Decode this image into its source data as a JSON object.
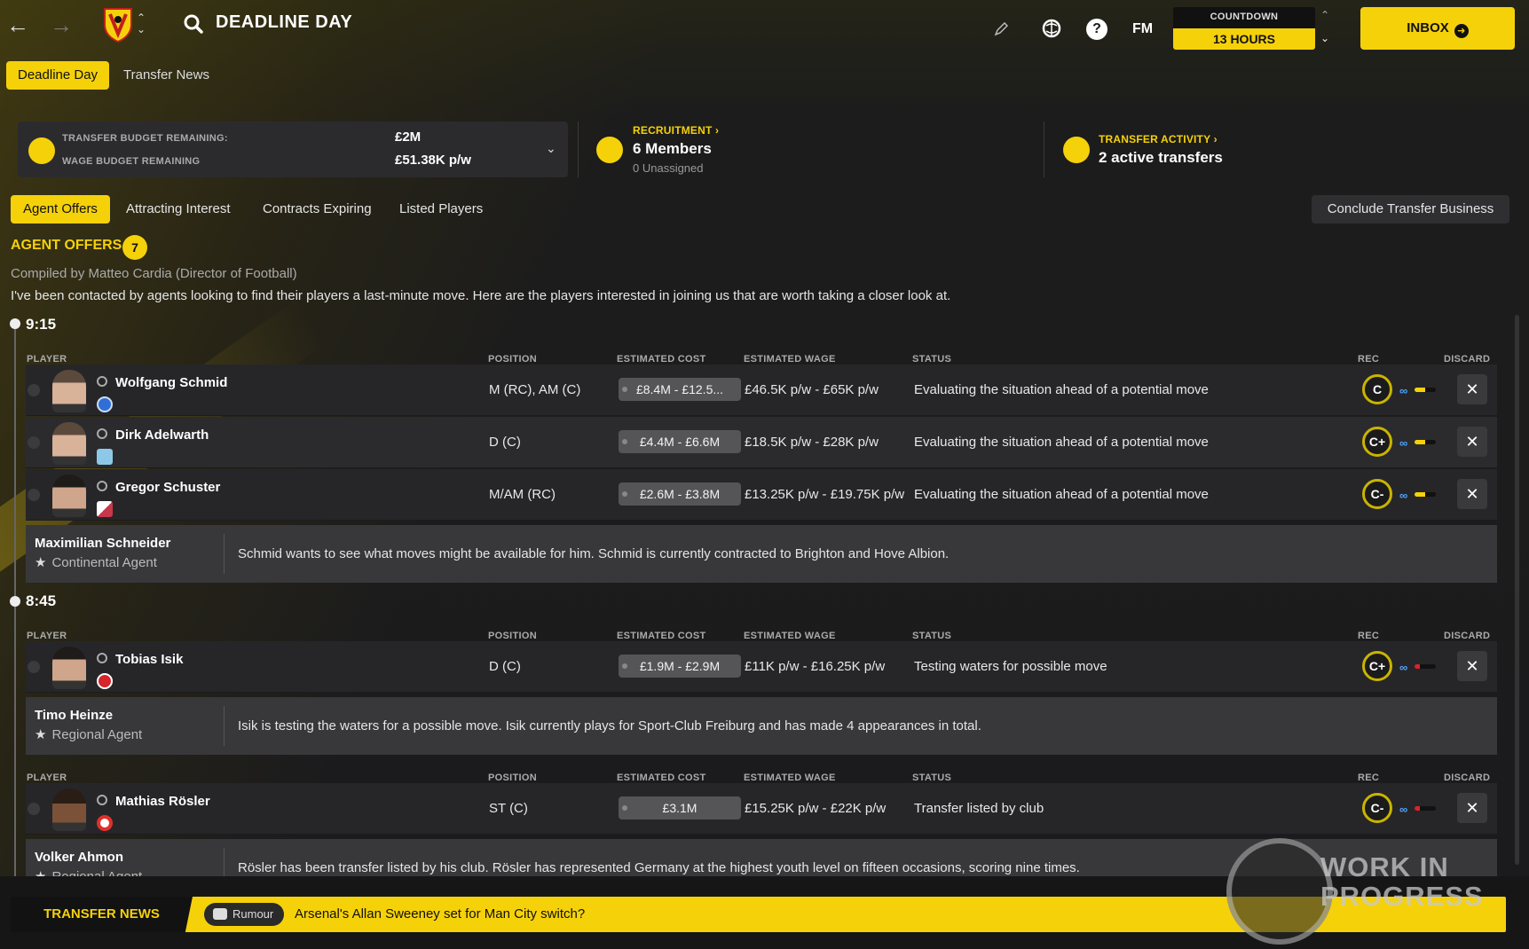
{
  "topbar": {
    "title": "DEADLINE DAY",
    "countdown_label": "COUNTDOWN",
    "countdown_value": "13 HOURS",
    "fm_label": "FM",
    "help_label": "?",
    "inbox_label": "INBOX"
  },
  "subtabs": [
    "Deadline Day",
    "Transfer News"
  ],
  "budget": {
    "transfer_label": "TRANSFER BUDGET REMAINING:",
    "transfer_value": "£2M",
    "wage_label": "WAGE BUDGET REMAINING",
    "wage_value": "£51.38K p/w"
  },
  "recruitment": {
    "link": "RECRUITMENT ›",
    "members": "6 Members",
    "unassigned": "0 Unassigned"
  },
  "transfer_activity": {
    "link": "TRANSFER ACTIVITY ›",
    "value": "2 active transfers"
  },
  "filter_tabs": [
    "Agent Offers",
    "Attracting Interest",
    "Contracts Expiring",
    "Listed Players"
  ],
  "conclude_label": "Conclude Transfer Business",
  "section": {
    "title": "AGENT OFFERS",
    "count": "7",
    "compiled": "Compiled by Matteo Cardia (Director of Football)",
    "intro": "I've been contacted by agents looking to find their players a last-minute move. Here are the players interested in joining us that are worth taking a closer look at."
  },
  "columns": {
    "player": "PLAYER",
    "position": "POSITION",
    "cost": "ESTIMATED COST",
    "wage": "ESTIMATED WAGE",
    "status": "STATUS",
    "rec": "REC",
    "discard": "DISCARD"
  },
  "groups": [
    {
      "time": "9:15",
      "players": [
        {
          "name": "Wolfgang Schmid",
          "position": "M (RC), AM (C)",
          "cost": "£8.4M - £12.5...",
          "wage": "£46.5K p/w - £65K p/w",
          "status": "Evaluating the situation ahead of a potential move",
          "rec": "C",
          "club_color": "#2f6fd6"
        },
        {
          "name": "Dirk Adelwarth",
          "position": "D (C)",
          "cost": "£4.4M - £6.6M",
          "wage": "£18.5K p/w - £28K p/w",
          "status": "Evaluating the situation ahead of a potential move",
          "rec": "C+",
          "club_color": "#8ec8e8"
        },
        {
          "name": "Gregor Schuster",
          "position": "M/AM (RC)",
          "cost": "£2.6M - £3.8M",
          "wage": "£13.25K p/w - £19.75K p/w",
          "status": "Evaluating the situation ahead of a potential move",
          "rec": "C-",
          "club_color": "#c9374a"
        }
      ],
      "agent": {
        "name": "Maximilian Schneider",
        "role": "Continental Agent",
        "message": "Schmid wants to see what moves might be available for him. Schmid is currently contracted to Brighton and Hove Albion."
      }
    },
    {
      "time": "8:45",
      "players": [
        {
          "name": "Tobias Isik",
          "position": "D (C)",
          "cost": "£1.9M - £2.9M",
          "wage": "£11K p/w - £16.25K p/w",
          "status": "Testing waters for possible move",
          "rec": "C+",
          "club_color": "#d8242b"
        }
      ],
      "agent": {
        "name": "Timo Heinze",
        "role": "Regional Agent",
        "message": "Isik is testing the waters for a possible move. Isik currently plays for Sport-Club Freiburg and has made 4 appearances in total."
      }
    },
    {
      "players": [
        {
          "name": "Mathias Rösler",
          "position": "ST (C)",
          "cost": "£3.1M",
          "wage": "£15.25K p/w - £22K p/w",
          "status": "Transfer listed by club",
          "rec": "C-",
          "club_color": "#e0302b"
        }
      ],
      "agent": {
        "name": "Volker Ahmon",
        "role": "Regional Agent",
        "message": "Rösler has been transfer listed by his club. Rösler has represented Germany at the highest youth level on fifteen occasions, scoring nine times."
      }
    }
  ],
  "ticker": {
    "label": "TRANSFER NEWS",
    "badge": "Rumour",
    "text": "Arsenal's Allan Sweeney set for Man City switch?"
  },
  "watermark": {
    "line1": "WORK IN",
    "line2": "PROGRESS"
  },
  "colors": {
    "accent": "#f5d10a",
    "background": "#1b1b1d",
    "row": "#262629",
    "agent_box": "#38383b"
  }
}
